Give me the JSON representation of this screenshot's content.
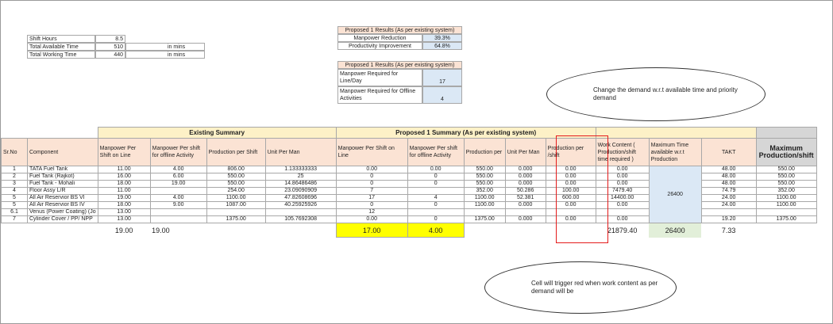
{
  "shift_table": {
    "rows": [
      {
        "label": "Shift Hours",
        "value": "8.5",
        "unit": ""
      },
      {
        "label": "Total Available Time",
        "value": "510",
        "unit": "in mins"
      },
      {
        "label": "Total Working Time",
        "value": "440",
        "unit": "in mins"
      }
    ]
  },
  "results1": {
    "title": "Proposed 1 Results  (As per existing system)",
    "rows": [
      {
        "label": "Manpower Reduction",
        "value": "39.3%"
      },
      {
        "label": "Productivity Improvement",
        "value": "64.8%"
      }
    ]
  },
  "results2": {
    "title": "Proposed 1 Results  (As per existing system)",
    "rows": [
      {
        "label": "Manpower Required for Line/Day",
        "value": "17"
      },
      {
        "label": "Manpower Required for Offline Activities",
        "value": "4"
      }
    ]
  },
  "callout_top": "Change the demand w.r.t available time and priority demand",
  "callout_bottom": "Cell will trigger red when work content as per demand will be",
  "table": {
    "band_existing": "Existing Summary",
    "band_proposed": "Proposed 1  Summary (As per existing system)",
    "headers": {
      "sr": "Sr.No",
      "component": "Component",
      "mp_line": "Manpower Per Shift on Line",
      "mp_offline": "Manpower Per shift for offline Activity",
      "prod_shift": "Production per Shift",
      "unit_man": "Unit Per Man",
      "p_mp_line": "Manpower Per Shift on Line",
      "p_mp_offline": "Manpower Per shift for offline Activity",
      "p_prod": "Production per",
      "p_unit": "Unit Per Man",
      "p_prod_shift": "Production per /shift",
      "work_content": "Work Content ( Production/shift time required )",
      "max_time": "Maximum Time available w.r.t Production",
      "takt": "TAKT",
      "max_prod": "Maximum Production/shift"
    },
    "rows": [
      {
        "sr": "1",
        "component": "TATA Fuel Tank",
        "mp_line": "11.00",
        "mp_offline": "4.00",
        "prod_shift": "806.00",
        "unit_man": "1.133333333",
        "p_mp_line": "0.00",
        "p_mp_offline": "0.00",
        "p_prod": "550.00",
        "p_unit": "0.000",
        "p_prod_shift": "0.00",
        "work_content": "0.00",
        "takt": "48.00",
        "max_prod": "550.00"
      },
      {
        "sr": "2",
        "component": "Fuel Tank (Rajkot)",
        "mp_line": "16.00",
        "mp_offline": "6.00",
        "prod_shift": "550.00",
        "unit_man": "25",
        "p_mp_line": "0",
        "p_mp_offline": "0",
        "p_prod": "550.00",
        "p_unit": "0.000",
        "p_prod_shift": "0.00",
        "work_content": "0.00",
        "takt": "48.00",
        "max_prod": "550.00"
      },
      {
        "sr": "3",
        "component": "Fuel Tank - Mohali",
        "mp_line": "18.00",
        "mp_offline": "19.00",
        "prod_shift": "550.00",
        "unit_man": "14.86486486",
        "p_mp_line": "0",
        "p_mp_offline": "0",
        "p_prod": "550.00",
        "p_unit": "0.000",
        "p_prod_shift": "0.00",
        "work_content": "0.00",
        "takt": "48.00",
        "max_prod": "550.00"
      },
      {
        "sr": "4",
        "component": "Floor Assy L/R",
        "mp_line": "11.00",
        "mp_offline": "",
        "prod_shift": "254.00",
        "unit_man": "23.09090909",
        "p_mp_line": "7",
        "p_mp_offline": "",
        "p_prod": "352.00",
        "p_unit": "50.286",
        "p_prod_shift": "100.00",
        "work_content": "7479.40",
        "takt": "74.79",
        "max_prod": "352.00"
      },
      {
        "sr": "5",
        "component": "All Air Reservior BS VI",
        "mp_line": "19.00",
        "mp_offline": "4.00",
        "prod_shift": "1100.00",
        "unit_man": "47.82608696",
        "p_mp_line": "17",
        "p_mp_offline": "4",
        "p_prod": "1100.00",
        "p_unit": "52.381",
        "p_prod_shift": "600.00",
        "work_content": "14400.00",
        "takt": "24.00",
        "max_prod": "1100.00"
      },
      {
        "sr": "5",
        "component": "All Air Reservior BS IV",
        "mp_line": "18.00",
        "mp_offline": "9.00",
        "prod_shift": "1087.00",
        "unit_man": "40.25925926",
        "p_mp_line": "0",
        "p_mp_offline": "0",
        "p_prod": "1100.00",
        "p_unit": "0.000",
        "p_prod_shift": "0.00",
        "work_content": "0.00",
        "takt": "24.00",
        "max_prod": "1100.00"
      },
      {
        "sr": "6.1",
        "component": "Venus (Power Coating) (Jo",
        "mp_line": "13.00",
        "mp_offline": "",
        "prod_shift": "",
        "unit_man": "",
        "p_mp_line": "12",
        "p_mp_offline": "",
        "p_prod": "",
        "p_unit": "",
        "p_prod_shift": "",
        "work_content": "",
        "takt": "",
        "max_prod": ""
      },
      {
        "sr": "7",
        "component": "Cylinder Cover / PP/ NPP",
        "mp_line": "13.00",
        "mp_offline": "",
        "prod_shift": "1375.00",
        "unit_man": "105.7692308",
        "p_mp_line": "0.00",
        "p_mp_offline": "0",
        "p_prod": "1375.00",
        "p_unit": "0.000",
        "p_prod_shift": "0.00",
        "work_content": "0.00",
        "takt": "19.20",
        "max_prod": "1375.00"
      }
    ],
    "max_time_value": "26400",
    "totals": {
      "mp_line": "19.00",
      "mp_offline": "19.00",
      "p_mp_line": "17.00",
      "p_mp_offline": "4.00",
      "work_content": "21879.40",
      "max_time": "26400",
      "takt": "7.33"
    }
  },
  "colors": {
    "header_peach": "#fbe3d4",
    "band_yellow": "#fdf1c7",
    "input_blue": "#dbe8f5",
    "highlight_yellow": "#ffff00",
    "highlight_green": "#e2efd9",
    "alert_red": "#e41c1c"
  }
}
